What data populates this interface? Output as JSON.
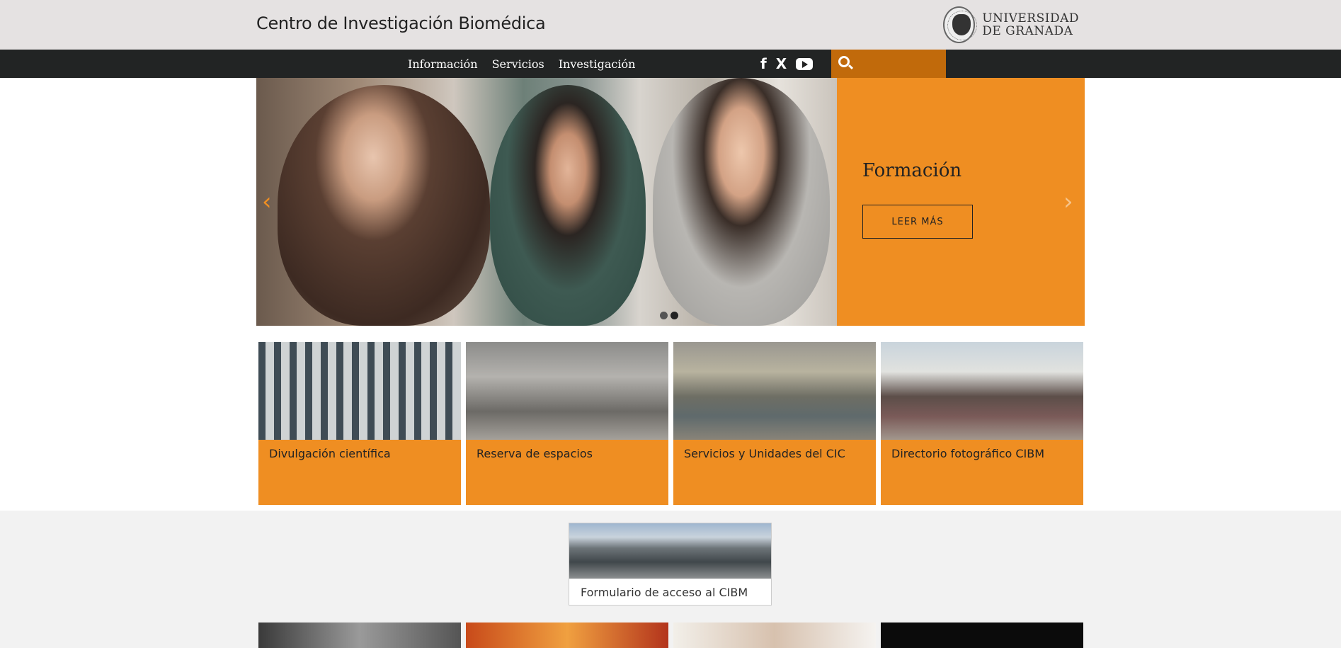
{
  "header": {
    "site_title": "Centro de Investigación Biomédica",
    "university_line1": "UNIVERSIDAD",
    "university_line2": "DE GRANADA"
  },
  "nav": {
    "links": [
      "Información",
      "Servicios",
      "Investigación"
    ],
    "social_icons": [
      "facebook-icon",
      "x-icon",
      "youtube-icon"
    ],
    "search_placeholder": "",
    "utility_icons": [
      "mail-icon",
      "contact-card-icon",
      "users-icon",
      "home-icon",
      "info-icon"
    ]
  },
  "slider": {
    "title": "Formación",
    "button_label": "LEER MÁS",
    "prev": "‹",
    "next": "›",
    "slide_count": 2,
    "active_slide": 2
  },
  "tiles": [
    {
      "label": "Divulgación científica"
    },
    {
      "label": "Reserva de espacios"
    },
    {
      "label": "Servicios y Unidades del CIC"
    },
    {
      "label": "Directorio fotográfico CIBM"
    }
  ],
  "form_card": {
    "label": "Formulario de acceso al CIBM"
  },
  "colors": {
    "accent": "#ef8e22",
    "dark_accent": "#c16a0b",
    "navbar": "#222424",
    "topbar": "#e5e2e2"
  }
}
